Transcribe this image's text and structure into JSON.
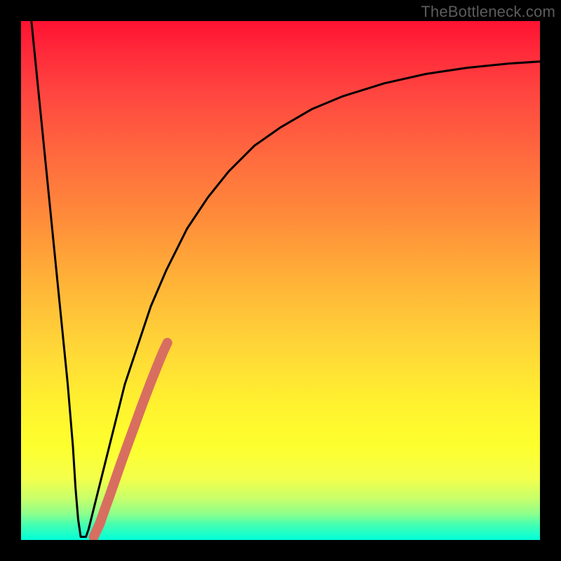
{
  "watermark": "TheBottleneck.com",
  "colors": {
    "frame": "#000000",
    "curve": "#000000",
    "marker": "#d86e60"
  },
  "chart_data": {
    "type": "line",
    "title": "",
    "xlabel": "",
    "ylabel": "",
    "xlim": [
      0,
      100
    ],
    "ylim": [
      0,
      100
    ],
    "grid": false,
    "legend": false,
    "series": [
      {
        "name": "curve",
        "x": [
          2,
          3,
          4,
          5,
          6,
          7,
          8,
          9,
          10,
          10.5,
          11,
          11.5,
          12,
          12.5,
          13,
          14,
          16,
          18,
          20,
          22,
          25,
          28,
          32,
          36,
          40,
          45,
          50,
          56,
          62,
          70,
          78,
          86,
          94,
          100
        ],
        "y": [
          100,
          90,
          80,
          70,
          60,
          50,
          40,
          30,
          18,
          10,
          4,
          0.6,
          0.6,
          0.6,
          2,
          6,
          14,
          22,
          30,
          36,
          45,
          52,
          60,
          66,
          71,
          76,
          79.5,
          83,
          85.5,
          88,
          89.8,
          91,
          91.8,
          92.2
        ]
      }
    ],
    "markers": [
      {
        "x": 14.0,
        "y": 0.6
      },
      {
        "x": 15.2,
        "y": 3.2
      },
      {
        "x": 16.1,
        "y": 5.8
      },
      {
        "x": 17.0,
        "y": 8.3
      },
      {
        "x": 17.8,
        "y": 10.6
      },
      {
        "x": 18.6,
        "y": 12.9
      },
      {
        "x": 19.4,
        "y": 15.2
      },
      {
        "x": 20.2,
        "y": 17.4
      },
      {
        "x": 21.0,
        "y": 19.6
      },
      {
        "x": 21.8,
        "y": 21.8
      },
      {
        "x": 22.6,
        "y": 24.0
      },
      {
        "x": 23.4,
        "y": 26.2
      },
      {
        "x": 24.2,
        "y": 28.3
      },
      {
        "x": 25.0,
        "y": 30.4
      },
      {
        "x": 25.8,
        "y": 32.4
      },
      {
        "x": 26.6,
        "y": 34.4
      },
      {
        "x": 27.4,
        "y": 36.3
      },
      {
        "x": 28.2,
        "y": 38.0
      }
    ]
  }
}
